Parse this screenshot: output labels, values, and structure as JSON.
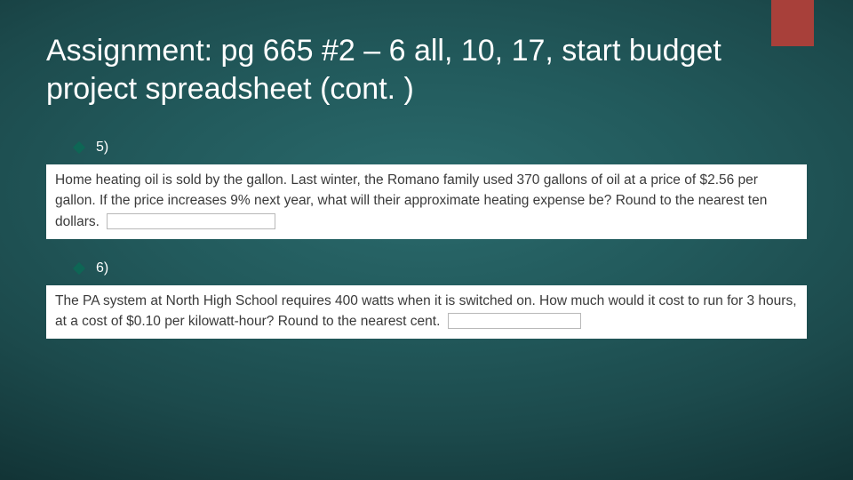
{
  "accent_color": "#a8403a",
  "title": "Assignment:  pg 665 #2 – 6 all, 10, 17, start budget project spreadsheet (cont. )",
  "bullets": {
    "b5": "5)",
    "b6": "6)"
  },
  "questions": {
    "q5": "Home heating oil is sold by the gallon. Last winter, the Romano family used 370 gallons of oil at a price of $2.56 per gallon. If the price increases 9% next year, what will their approximate heating expense be? Round to the nearest ten dollars.",
    "q6": "The PA system at North High School requires 400 watts when it is switched on. How much would it cost to run for 3 hours, at a cost of $0.10 per kilowatt-hour? Round to the nearest cent."
  }
}
